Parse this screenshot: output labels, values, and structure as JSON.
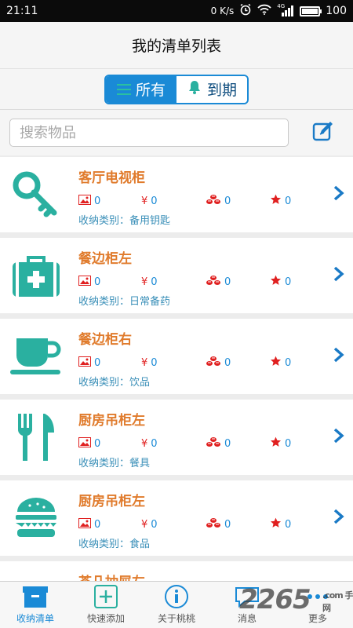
{
  "status": {
    "time": "21:11",
    "net_speed": "0 K/s",
    "signal": "4G",
    "battery": "100",
    "battery_level": 1.0
  },
  "header": {
    "title": "我的清单列表"
  },
  "filter": {
    "all_label": "所有",
    "due_label": "到期",
    "active": "all"
  },
  "search": {
    "placeholder": "搜索物品"
  },
  "category_prefix": "收纳类别：",
  "items": [
    {
      "title": "客厅电视柜",
      "icon": "key-icon",
      "images": "0",
      "price": "0",
      "coins": "0",
      "stars": "0",
      "category": "备用钥匙"
    },
    {
      "title": "餐边柜左",
      "icon": "first-aid-kit-icon",
      "images": "0",
      "price": "0",
      "coins": "0",
      "stars": "0",
      "category": "日常备药"
    },
    {
      "title": "餐边柜右",
      "icon": "teacup-icon",
      "images": "0",
      "price": "0",
      "coins": "0",
      "stars": "0",
      "category": "饮品"
    },
    {
      "title": "厨房吊柜左",
      "icon": "fork-knife-icon",
      "images": "0",
      "price": "0",
      "coins": "0",
      "stars": "0",
      "category": "餐具"
    },
    {
      "title": "厨房吊柜左",
      "icon": "burger-icon",
      "images": "0",
      "price": "0",
      "coins": "0",
      "stars": "0",
      "category": "食品"
    },
    {
      "title": "茶几抽屉左",
      "icon": "box-icon"
    }
  ],
  "tabs": [
    {
      "label": "收纳清单",
      "icon": "storage-box-icon",
      "active": true
    },
    {
      "label": "快速添加",
      "icon": "plus-icon",
      "active": false
    },
    {
      "label": "关于桃桃",
      "icon": "info-icon",
      "active": false
    },
    {
      "label": "消息",
      "icon": "chat-bubble-icon",
      "active": false
    },
    {
      "label": "更多",
      "icon": "more-icon",
      "active": false
    }
  ],
  "watermark": {
    "text": "2265",
    "sub": ".com 手游网"
  },
  "colors": {
    "accent": "#1a8ad6",
    "teal": "#2ab0a0",
    "title": "#e07b2c",
    "red": "#e02020"
  }
}
